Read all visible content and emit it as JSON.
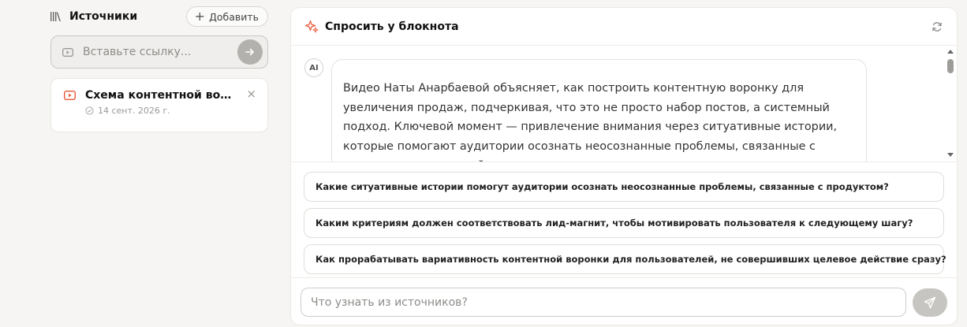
{
  "sources": {
    "title": "Источники",
    "add_label": "Добавить",
    "link_placeholder": "Вставьте ссылку...",
    "items": [
      {
        "name": "Схема контентной вор...",
        "date": "14 сент. 2026 г.",
        "close": "×"
      }
    ]
  },
  "chat": {
    "title": "Спросить у блокнота",
    "avatar_label": "AI",
    "ai_message": "Видео Наты Анарбаевой объясняет, как построить контентную воронку для увеличения продаж, подчеркивая, что это не просто набор постов, а системный подход. Ключевой момент — привлечение внимания через ситуативные истории, которые помогают аудитории осознать неосознанные проблемы, связанные с продуктом или услугой.",
    "suggestions": [
      "Какие ситуативные истории помогут аудитории осознать неосознанные проблемы, связанные с продуктом?",
      "Каким критериям должен соответствовать лид-магнит, чтобы мотивировать пользователя к следующему шагу?",
      "Как прорабатывать вариативность контентной воронки для пользователей, не совершивших целевое действие сразу?"
    ],
    "input_placeholder": "Что узнать из источников?"
  },
  "colors": {
    "accent": "#e8583a",
    "background": "#f6f5f3",
    "panel": "#ffffff",
    "send_button": "#c7c5c1"
  },
  "icons": {
    "sources": "books-icon",
    "add": "plus-icon",
    "link": "video-icon",
    "go": "arrow-right-icon",
    "source_type": "youtube-icon",
    "status": "check-circle-icon",
    "chat": "sparkle-icon",
    "refresh": "refresh-icon",
    "send": "send-icon"
  }
}
